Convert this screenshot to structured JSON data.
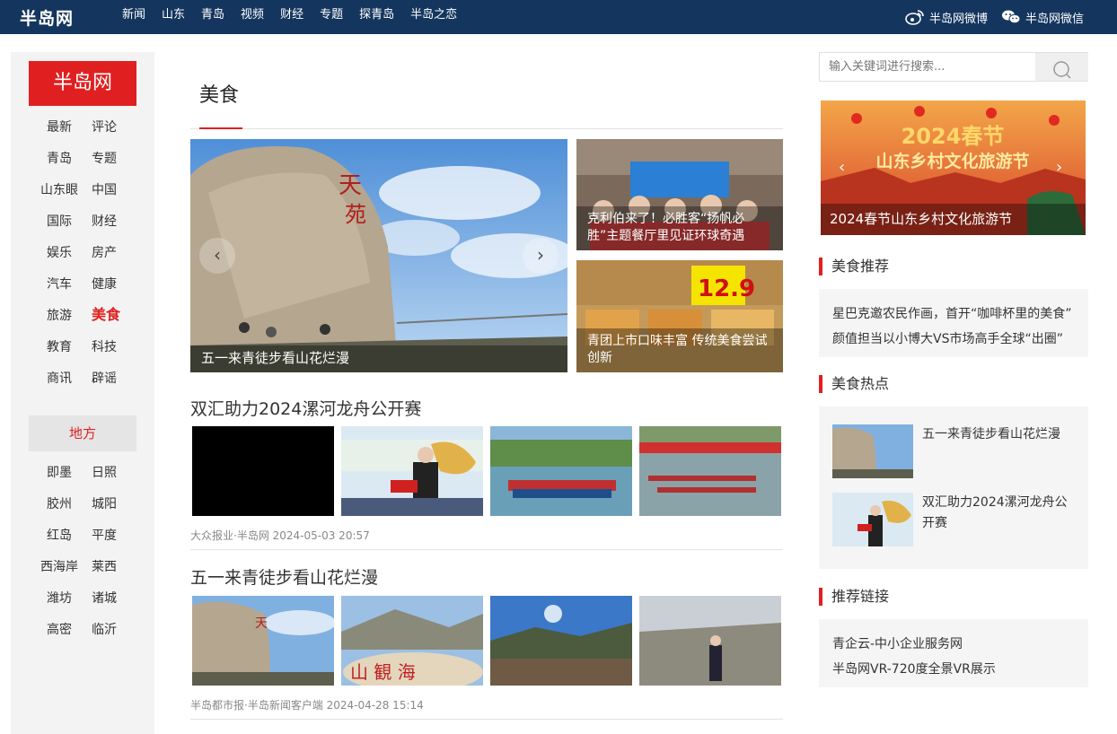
{
  "topbar": {
    "logo": "半岛网",
    "nav": [
      "新闻",
      "山东",
      "青岛",
      "视频",
      "财经",
      "专题",
      "探青岛",
      "半岛之恋"
    ],
    "weibo_label": "半岛网微博",
    "wechat_label": "半岛网微信",
    "bg_color": "#14365e"
  },
  "sidebar": {
    "brand": "半岛网",
    "rows": [
      [
        "最新",
        "评论"
      ],
      [
        "青岛",
        "专题"
      ],
      [
        "山东眼",
        "中国"
      ],
      [
        "国际",
        "财经"
      ],
      [
        "娱乐",
        "房产"
      ],
      [
        "汽车",
        "健康"
      ],
      [
        "旅游",
        "美食"
      ],
      [
        "教育",
        "科技"
      ],
      [
        "商讯",
        "辟谣"
      ]
    ],
    "active": "美食",
    "region_label": "地方",
    "region_rows": [
      [
        "即墨",
        "日照"
      ],
      [
        "胶州",
        "城阳"
      ],
      [
        "红岛",
        "平度"
      ],
      [
        "西海岸",
        "莱西"
      ],
      [
        "潍坊",
        "诸城"
      ],
      [
        "高密",
        "临沂"
      ]
    ],
    "accent_color": "#e02020"
  },
  "main": {
    "section_title": "美食",
    "hero_caption": "五一来青徒步看山花烂漫",
    "side_card_1": "克利伯来了！必胜客“扬帆必胜”主题餐厅里见证环球奇遇",
    "side_card_2": "青团上市口味丰富 传统美食尝试创新",
    "articles": [
      {
        "title": "双汇助力2024漯河龙舟公开赛",
        "meta": "大众报业·半岛网 2024-05-03 20:57"
      },
      {
        "title": "五一来青徒步看山花烂漫",
        "meta": "半岛都市报·半岛新闻客户端 2024-04-28 15:14"
      }
    ]
  },
  "right": {
    "search_placeholder": "输入关键词进行搜索...",
    "banner_caption": "2024春节山东乡村文化旅游节",
    "banner_art_title": "2024春节",
    "banner_art_subtitle": "山东乡村文化旅游节",
    "recommend_title": "美食推荐",
    "recommend_links": [
      "星巴克邀农民作画，首开“咖啡杯里的美食”",
      "颜值担当以小博大VS市场高手全球“出圈”"
    ],
    "hot_title": "美食热点",
    "hot_items": [
      "五一来青徒步看山花烂漫",
      "双汇助力2024漯河龙舟公开赛"
    ],
    "links_title": "推荐链接",
    "links": [
      "青企云-中小企业服务网",
      "半岛网VR-720度全景VR展示"
    ]
  }
}
